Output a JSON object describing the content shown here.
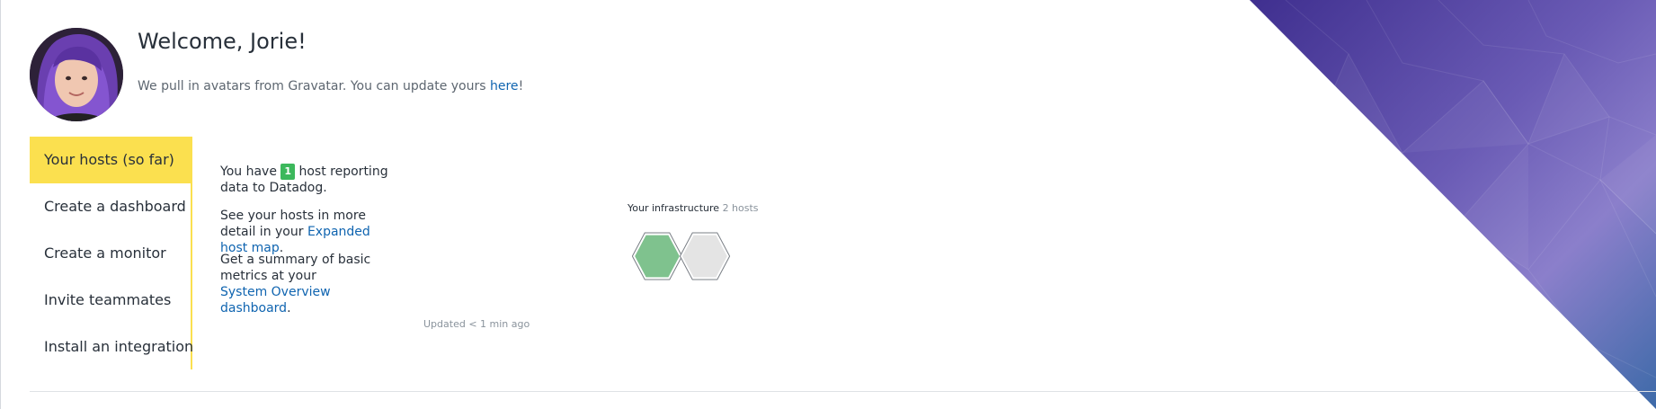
{
  "header": {
    "welcome": "Welcome, Jorie!",
    "gravatar_prefix": "We pull in avatars from Gravatar. You can update yours ",
    "gravatar_link": "here",
    "gravatar_suffix": "!"
  },
  "sidebar": {
    "items": [
      {
        "label": "Your hosts (so far)",
        "active": true
      },
      {
        "label": "Create a dashboard"
      },
      {
        "label": "Create a monitor"
      },
      {
        "label": "Invite teammates"
      },
      {
        "label": "Install an integration"
      }
    ]
  },
  "hosts_panel": {
    "p1_prefix": "You have ",
    "host_count": "1",
    "p1_suffix": " host reporting data to Datadog.",
    "p2_prefix": "See your hosts in more detail in your ",
    "p2_link": "Expanded host map",
    "p2_suffix": ".",
    "p3_prefix": "Get a summary of basic metrics at your ",
    "p3_link": "System Overview dashboard",
    "p3_suffix": ".",
    "updated": "Updated < 1 min ago"
  },
  "infrastructure": {
    "label": "Your infrastructure",
    "count": "2 hosts",
    "hosts": [
      {
        "status": "reporting",
        "color": "#7fc28e"
      },
      {
        "status": "inactive",
        "color": "#e4e4e4"
      }
    ]
  },
  "colors": {
    "accent_yellow": "#fbe04f",
    "link_blue": "#0f64b0",
    "badge_green": "#3cb85c"
  },
  "icons": [
    "user-avatar"
  ]
}
